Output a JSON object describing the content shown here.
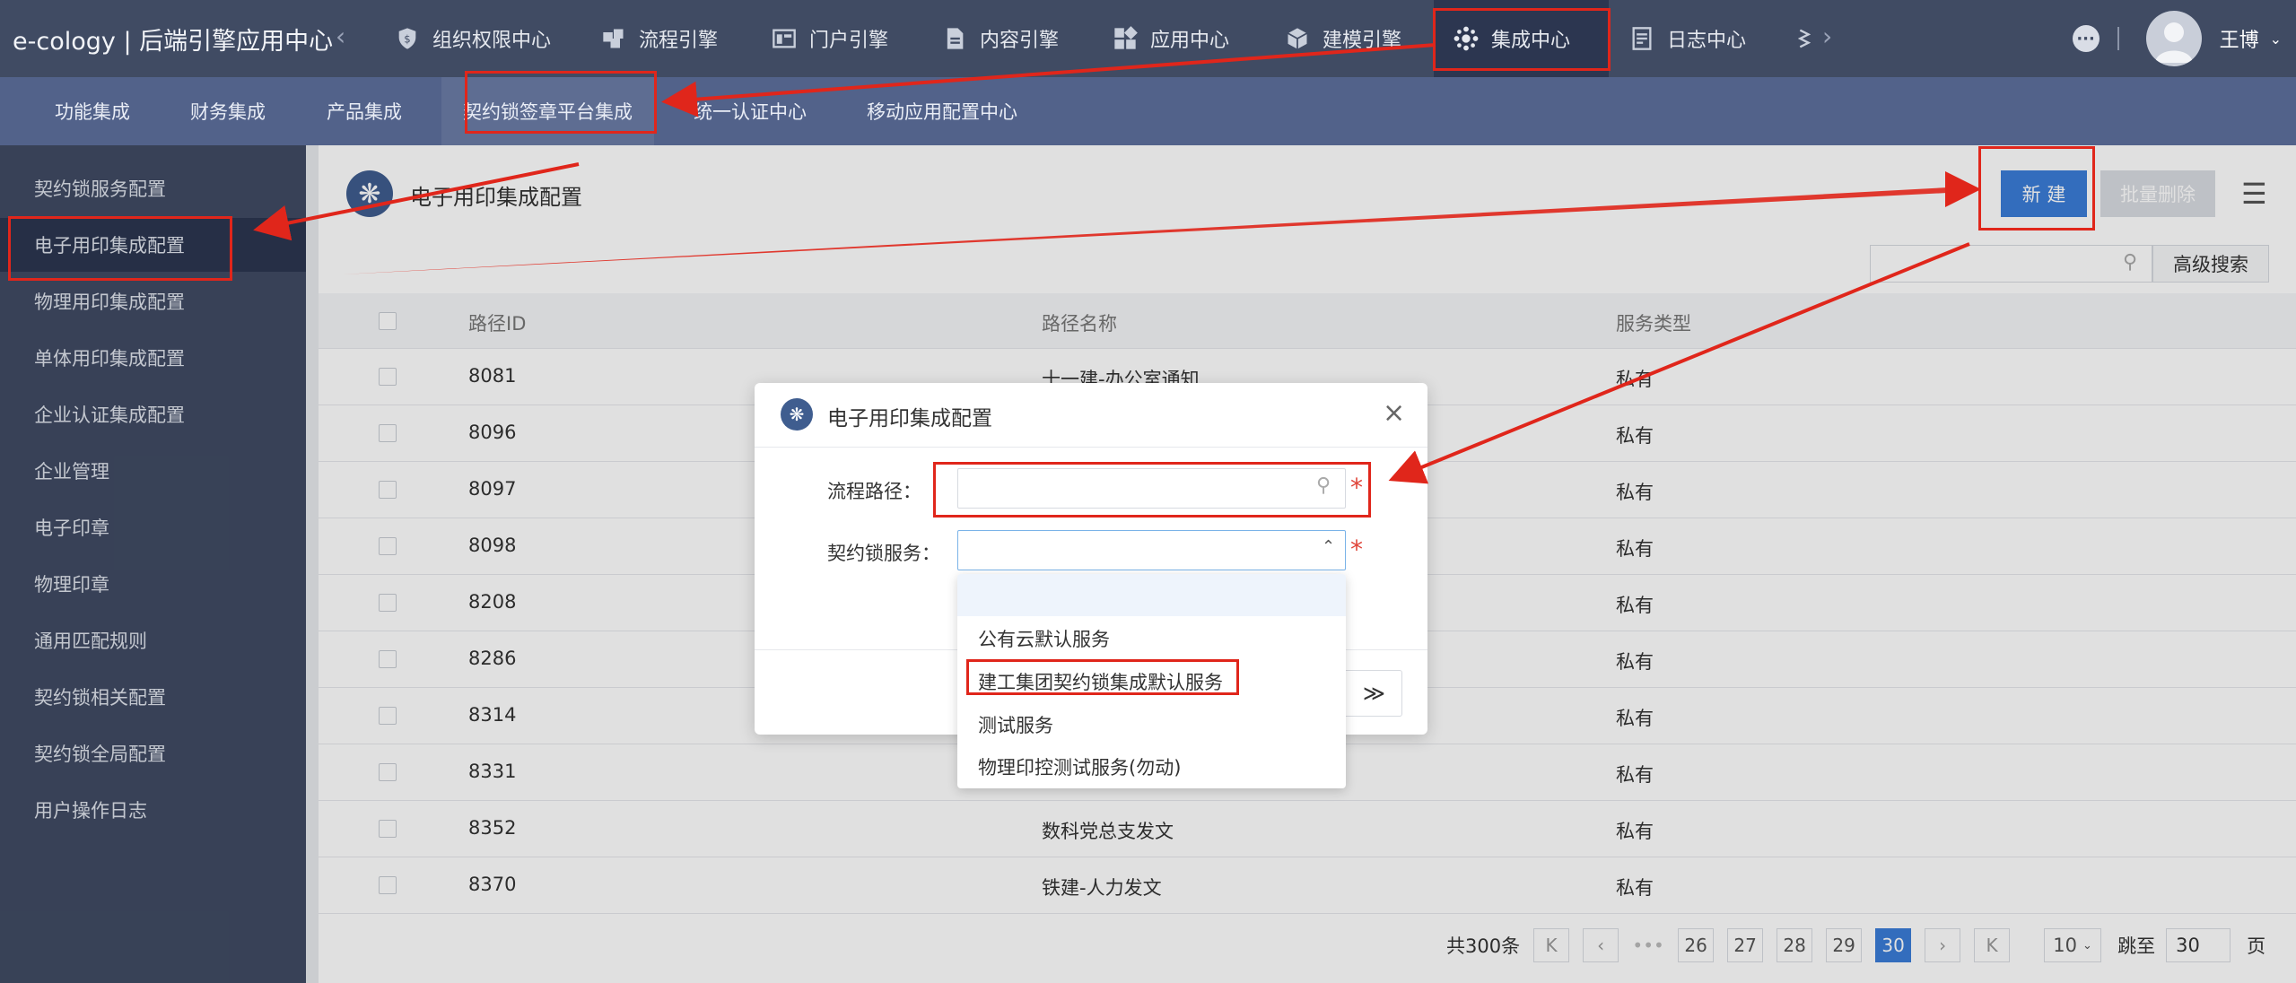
{
  "header": {
    "app_title": "e-cology | 后端引擎应用中心",
    "nav_items": [
      {
        "label": "组织权限中心",
        "icon": "shield-icon"
      },
      {
        "label": "流程引擎",
        "icon": "workflow-icon"
      },
      {
        "label": "门户引擎",
        "icon": "portal-icon"
      },
      {
        "label": "内容引擎",
        "icon": "document-icon"
      },
      {
        "label": "应用中心",
        "icon": "apps-icon"
      },
      {
        "label": "建模引擎",
        "icon": "cube-icon"
      },
      {
        "label": "集成中心",
        "icon": "integration-icon"
      },
      {
        "label": "日志中心",
        "icon": "log-icon"
      }
    ],
    "user_name": "王博"
  },
  "subnav": {
    "items": [
      "功能集成",
      "财务集成",
      "产品集成",
      "契约锁签章平台集成",
      "统一认证中心",
      "移动应用配置中心"
    ],
    "active_index": 3
  },
  "sidebar": {
    "items": [
      "契约锁服务配置",
      "电子用印集成配置",
      "物理用印集成配置",
      "单体用印集成配置",
      "企业认证集成配置",
      "企业管理",
      "电子印章",
      "物理印章",
      "通用匹配规则",
      "契约锁相关配置",
      "契约锁全局配置",
      "用户操作日志"
    ],
    "active_index": 1
  },
  "page": {
    "title": "电子用印集成配置",
    "new_button": "新 建",
    "batch_delete_button": "批量删除",
    "advanced_search": "高级搜索"
  },
  "table": {
    "headers": [
      "路径ID",
      "路径名称",
      "服务类型"
    ],
    "rows": [
      [
        "8081",
        "十一建-办公室通知",
        "私有"
      ],
      [
        "8096",
        "",
        "私有"
      ],
      [
        "8097",
        "",
        "私有"
      ],
      [
        "8098",
        "",
        "私有"
      ],
      [
        "8208",
        "",
        "私有"
      ],
      [
        "8286",
        "",
        "私有"
      ],
      [
        "8314",
        "",
        "私有"
      ],
      [
        "8331",
        "",
        "私有"
      ],
      [
        "8352",
        "数科党总支发文",
        "私有"
      ],
      [
        "8370",
        "铁建-人力发文",
        "私有"
      ]
    ]
  },
  "pagination": {
    "total": "共300条",
    "pages": [
      "26",
      "27",
      "28",
      "29",
      "30"
    ],
    "current": "30",
    "page_size": "10",
    "jump_label": "跳至",
    "jump_value": "30",
    "page_unit": "页"
  },
  "modal": {
    "title": "电子用印集成配置",
    "path_label": "流程路径：",
    "service_label": "契约锁服务：",
    "required_mark": "*",
    "footer_button_glyph": "≫",
    "options": [
      "",
      "公有云默认服务",
      "建工集团契约锁集成默认服务",
      "测试服务",
      "物理印控测试服务(勿动)"
    ]
  },
  "colors": {
    "topbar": "#404b63",
    "subnav": "#52628a",
    "primary": "#3b7dd8",
    "annotation": "#e0261b"
  }
}
